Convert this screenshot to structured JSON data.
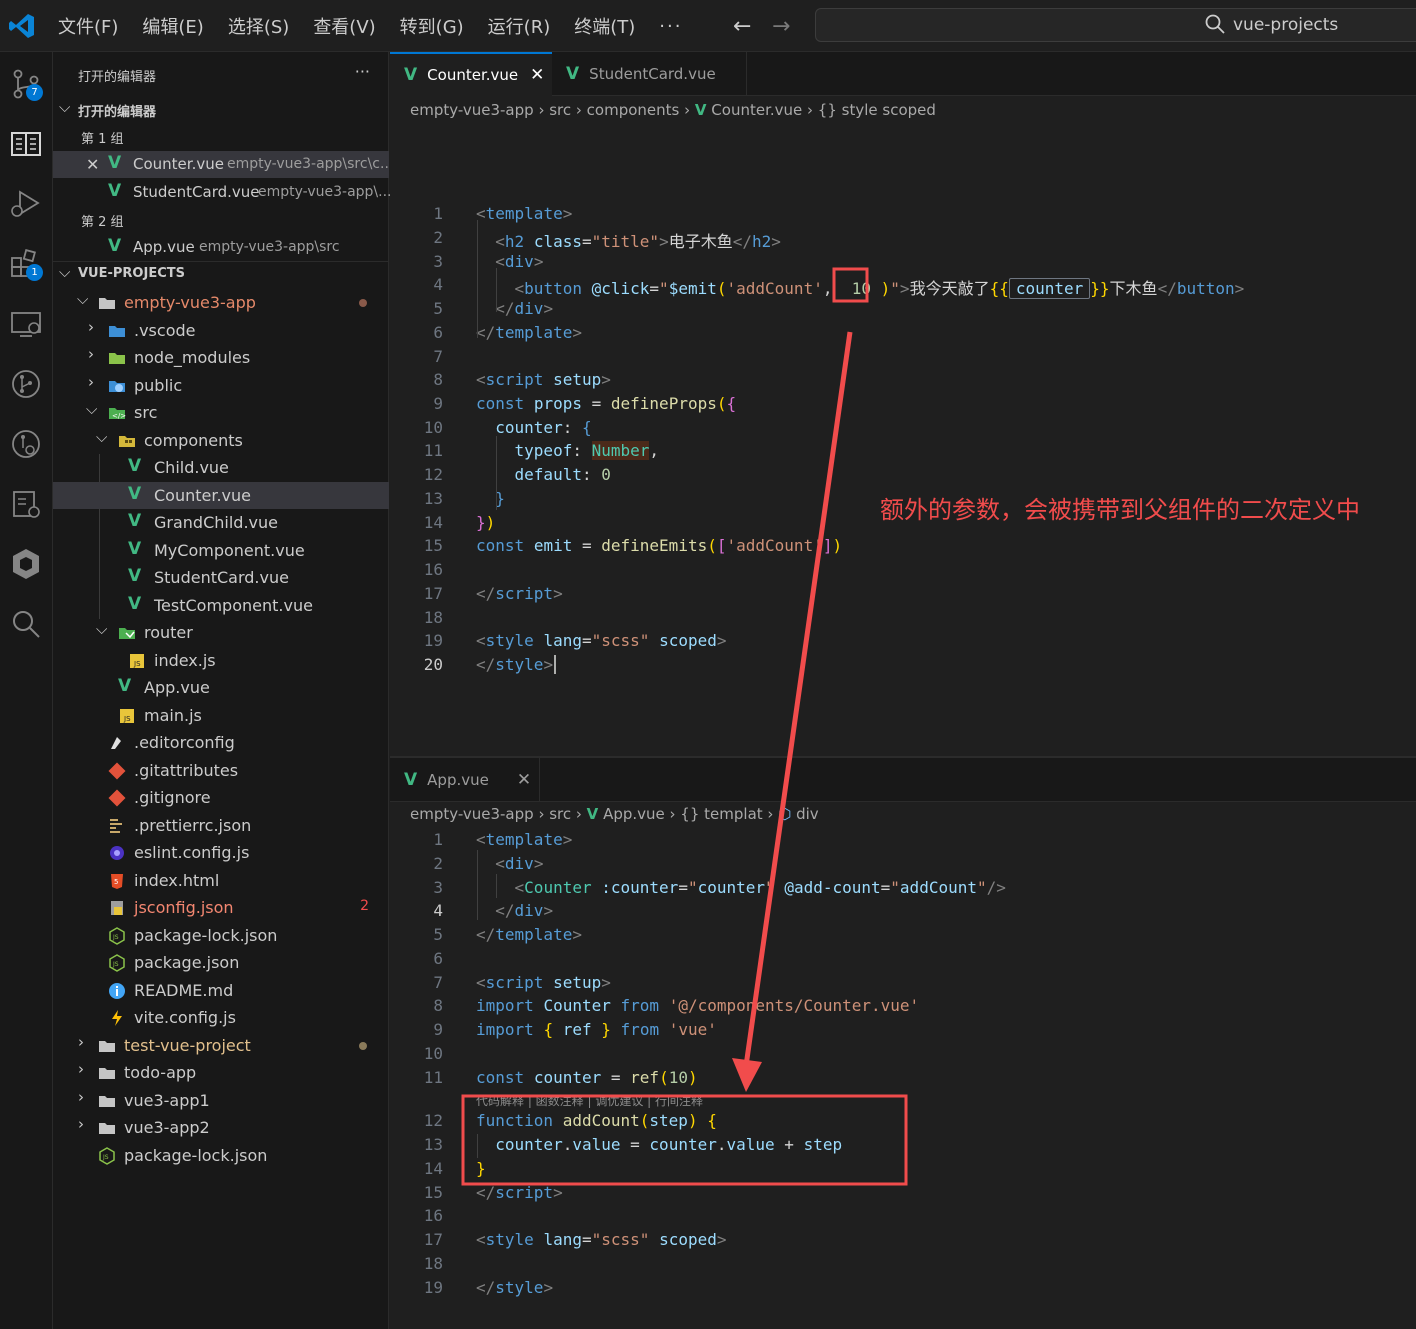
{
  "titlebar": {
    "menu": [
      "文件(F)",
      "编辑(E)",
      "选择(S)",
      "查看(V)",
      "转到(G)",
      "运行(R)",
      "终端(T)"
    ],
    "more": "···",
    "search_text": "vue-projects"
  },
  "activity": {
    "source_control_badge": "7",
    "extensions_badge": "1"
  },
  "sidebar": {
    "open_editors_title": "打开的编辑器",
    "more": "···",
    "open_editors_section": "打开的编辑器",
    "group1": "第 1 组",
    "group2": "第 2 组",
    "open1_name": "Counter.vue",
    "open1_path": "empty-vue3-app\\src\\c...",
    "open2_name": "StudentCard.vue",
    "open2_path": "empty-vue3-app\\...",
    "open3_name": "App.vue",
    "open3_path": "empty-vue3-app\\src",
    "project_title": "VUE-PROJECTS",
    "tree": {
      "empty_vue3_app": "empty-vue3-app",
      "vscode": ".vscode",
      "node_modules": "node_modules",
      "public": "public",
      "src": "src",
      "components": "components",
      "child": "Child.vue",
      "counter": "Counter.vue",
      "grandchild": "GrandChild.vue",
      "mycomponent": "MyComponent.vue",
      "studentcard": "StudentCard.vue",
      "testcomponent": "TestComponent.vue",
      "router": "router",
      "indexjs": "index.js",
      "appvue": "App.vue",
      "mainjs": "main.js",
      "editorconfig": ".editorconfig",
      "gitattributes": ".gitattributes",
      "gitignore": ".gitignore",
      "prettierrc": ".prettierrc.json",
      "eslint": "eslint.config.js",
      "indexhtml": "index.html",
      "jsconfig": "jsconfig.json",
      "jsconfig_errors": "2",
      "pkglock": "package-lock.json",
      "pkg": "package.json",
      "readme": "README.md",
      "vite": "vite.config.js",
      "test_vue_project": "test-vue-project",
      "todo_app": "todo-app",
      "vue3_app1": "vue3-app1",
      "vue3_app2": "vue3-app2",
      "root_pkglock": "package-lock.json"
    }
  },
  "editor_top": {
    "tab_active": "Counter.vue",
    "tab_inactive": "StudentCard.vue",
    "crumbs": [
      "empty-vue3-app",
      "src",
      "components",
      "Counter.vue",
      "style scoped"
    ],
    "line_numbers": [
      "1",
      "2",
      "3",
      "4",
      "5",
      "6",
      "7",
      "8",
      "9",
      "10",
      "11",
      "12",
      "13",
      "14",
      "15",
      "16",
      "17",
      "18",
      "19",
      "20"
    ],
    "code": {
      "l1": "template",
      "l2_tag": "h2",
      "l2_attr": "class",
      "l2_val": "\"title\"",
      "l2_text": "电子木鱼",
      "l2_close": "h2",
      "l3": "div",
      "l4_tag": "button",
      "l4_attr": "@click",
      "l4_emit": "$emit",
      "l4_arg": "'addCount'",
      "l4_num": "10",
      "l4_text1": "我今天敲了",
      "l4_var": "counter",
      "l4_text2": "下木鱼",
      "l4_close": "button",
      "l5": "div",
      "l6": "template",
      "l8_tag": "script",
      "l8_attr": "setup",
      "l9_kw": "const",
      "l9_var": "props",
      "l9_fn": "defineProps",
      "l10": "counter",
      "l11_key": "typeof",
      "l11_val": "Number",
      "l12_key": "default",
      "l12_val": "0",
      "l15_kw": "const",
      "l15_var": "emit",
      "l15_fn": "defineEmits",
      "l15_arg": "'addCount'",
      "l17": "script",
      "l19_tag": "style",
      "l19_attr": "lang",
      "l19_val": "\"scss\"",
      "l19_attr2": "scoped",
      "l20": "style"
    }
  },
  "editor_bottom": {
    "tab_active": "App.vue",
    "crumbs": [
      "empty-vue3-app",
      "src",
      "App.vue",
      "templat",
      "div"
    ],
    "line_numbers": [
      "1",
      "2",
      "3",
      "4",
      "5",
      "6",
      "7",
      "8",
      "9",
      "10",
      "11",
      "12",
      "13",
      "14",
      "15",
      "16",
      "17",
      "18",
      "19"
    ],
    "codelens": "代码解释 | 函数注释 | 调优建议 | 行间注释",
    "code": {
      "l1": "template",
      "l2": "div",
      "l3_comp": "Counter",
      "l3_attr1": ":counter",
      "l3_val1": "\"counter\"",
      "l3_attr2": "@add-count",
      "l3_val2": "\"addCount\"",
      "l4": "div",
      "l5": "template",
      "l7_tag": "script",
      "l7_attr": "setup",
      "l8_kw": "import",
      "l8_name": "Counter",
      "l8_from": "from",
      "l8_path": "'@/components/Counter.vue'",
      "l9_kw": "import",
      "l9_name": "ref",
      "l9_from": "from",
      "l9_path": "'vue'",
      "l11_kw": "const",
      "l11_var": "counter",
      "l11_fn": "ref",
      "l11_num": "10",
      "l12_kw": "function",
      "l12_fn": "addCount",
      "l12_arg": "step",
      "l13_a": "counter",
      "l13_b": "value",
      "l13_c": "counter",
      "l13_d": "value",
      "l13_e": "step",
      "l15": "script",
      "l17_tag": "style",
      "l17_attr": "lang",
      "l17_val": "\"scss\"",
      "l17_attr2": "scoped",
      "l19": "style"
    }
  },
  "annotation": {
    "text": "额外的参数，会被携带到父组件的二次定义中",
    "color": "#f14c4c"
  }
}
